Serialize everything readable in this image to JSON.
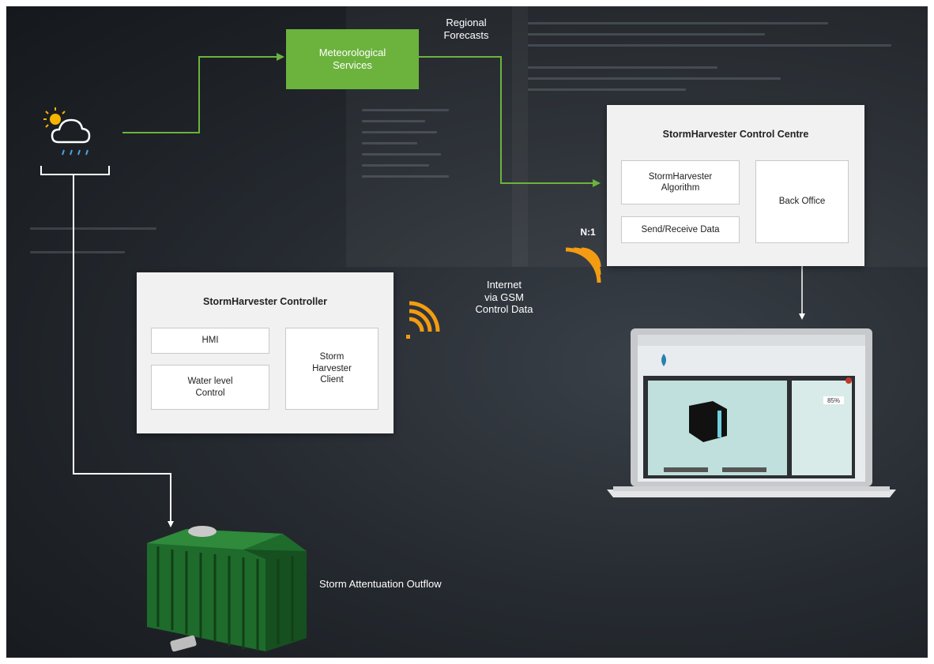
{
  "weather": {
    "icon": "cloud-sun-rain-icon"
  },
  "met_services": {
    "label_line1": "Meteorological",
    "label_line2": "Services"
  },
  "regional_forecasts": {
    "line1": "Regional",
    "line2": "Forecasts"
  },
  "control_centre": {
    "title": "StormHarvester Control Centre",
    "algorithm_line1": "StormHarvester",
    "algorithm_line2": "Algorithm",
    "send_receive": "Send/Receive Data",
    "back_office": "Back Office"
  },
  "ratio_label": "N:1",
  "internet": {
    "line1": "Internet",
    "line2": "via GSM",
    "line3": "Control Data"
  },
  "controller": {
    "title": "StormHarvester Controller",
    "hmi": "HMI",
    "water_line1": "Water level",
    "water_line2": "Control",
    "client_line1": "Storm",
    "client_line2": "Harvester",
    "client_line3": "Client"
  },
  "outflow_label": "Storm Attentuation Outflow",
  "laptop_screen": {
    "percent": "85%"
  },
  "colors": {
    "green": "#6cb33e",
    "orange": "#f39c12",
    "line": "#ffffff",
    "background": "#262b31"
  }
}
